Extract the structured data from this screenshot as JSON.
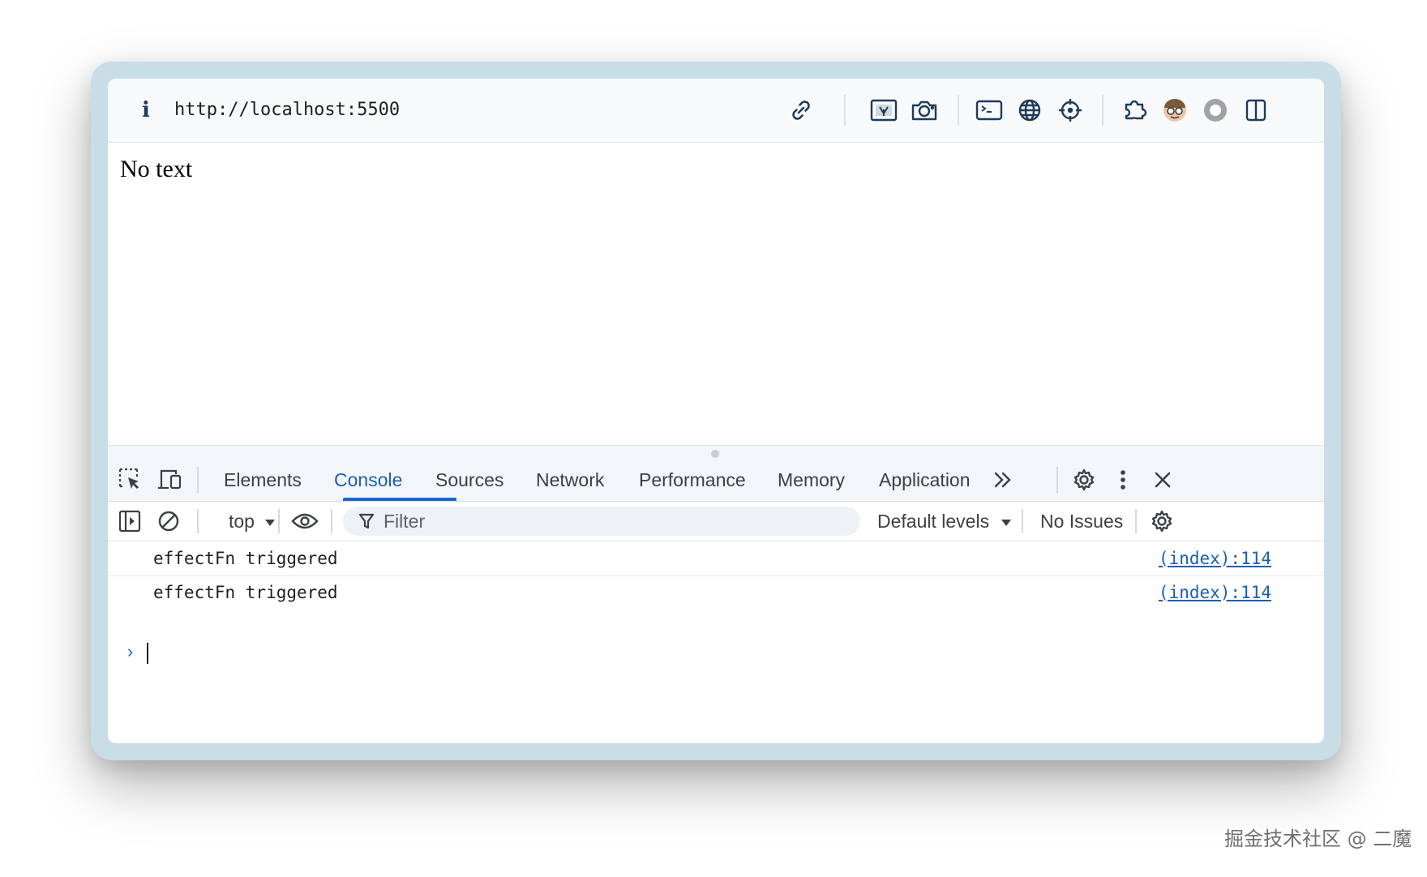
{
  "toolbar": {
    "info_glyph": "i",
    "url": "http://localhost:5500",
    "icons": [
      "link-icon",
      "qr-code-icon",
      "camera-icon",
      "terminal-icon",
      "globe-icon",
      "crosshair-icon",
      "extensions-icon",
      "avatar-icon",
      "record-icon",
      "split-panel-icon"
    ]
  },
  "page": {
    "text": "No text"
  },
  "devtools": {
    "tabs": [
      "Elements",
      "Console",
      "Sources",
      "Network",
      "Performance",
      "Memory",
      "Application"
    ],
    "active_tab": "Console",
    "more_tabs_glyph": "»",
    "accent_color": "#1a66d2"
  },
  "console": {
    "context": "top",
    "filter_placeholder": "Filter",
    "levels": "Default levels",
    "issues": "No Issues",
    "messages": [
      {
        "text": "effectFn triggered",
        "source": "(index):114"
      },
      {
        "text": "effectFn triggered",
        "source": "(index):114"
      }
    ],
    "prompt_glyph": "›"
  },
  "watermark": "掘金技术社区 @ 二魔"
}
